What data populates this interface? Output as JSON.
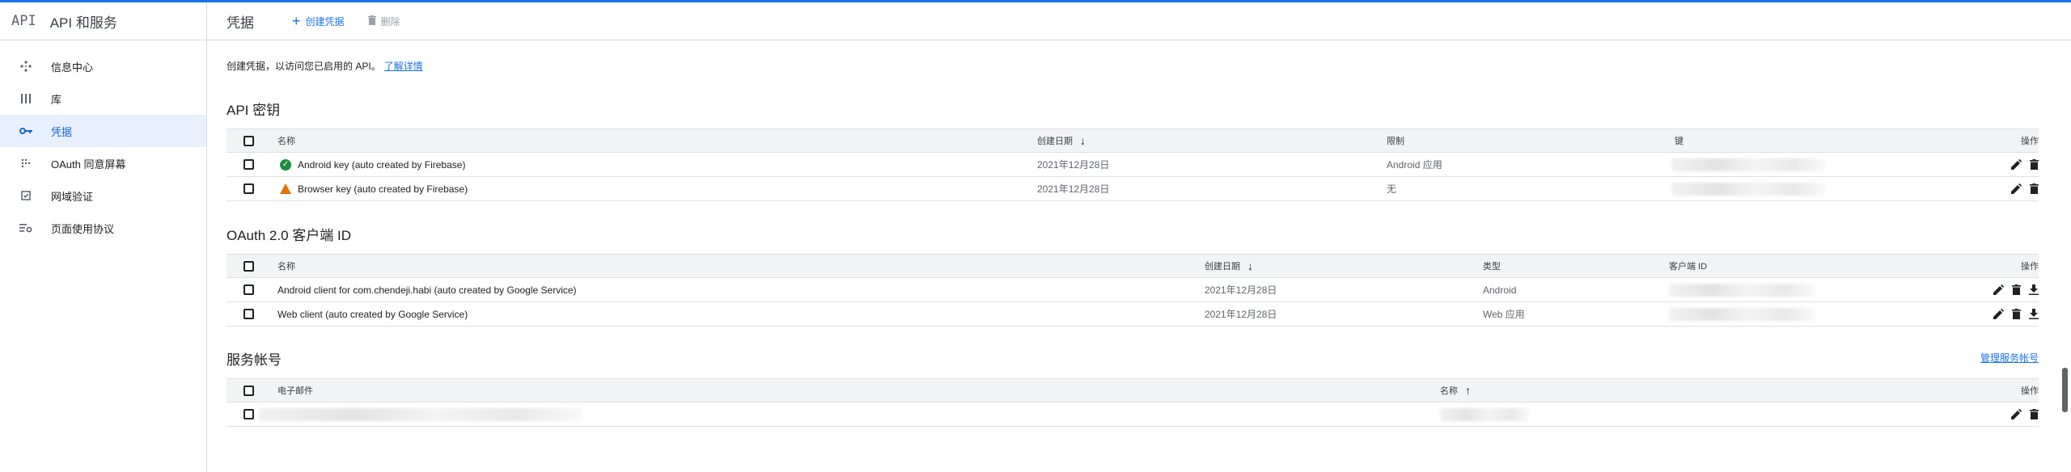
{
  "sidebar": {
    "logo": "API",
    "title": "API 和服务",
    "items": [
      {
        "label": "信息中心",
        "icon": "diamond-dots-icon"
      },
      {
        "label": "库",
        "icon": "library-grid-icon"
      },
      {
        "label": "凭据",
        "icon": "key-icon",
        "active": true
      },
      {
        "label": "OAuth 同意屏幕",
        "icon": "dots-grid-icon"
      },
      {
        "label": "网域验证",
        "icon": "checkbox-icon"
      },
      {
        "label": "页面使用协议",
        "icon": "settings-list-icon"
      }
    ]
  },
  "header": {
    "title": "凭据",
    "create_label": "创建凭据",
    "delete_label": "删除"
  },
  "main": {
    "intro_text": "创建凭据，以访问您已启用的 API。",
    "intro_link": "了解详情",
    "api_keys": {
      "title": "API 密钥",
      "headers": {
        "name": "名称",
        "created": "创建日期",
        "restriction": "限制",
        "key": "键",
        "actions": "操作"
      },
      "rows": [
        {
          "name": "Android key (auto created by Firebase)",
          "status": "ok",
          "created": "2021年12月28日",
          "restriction": "Android 应用"
        },
        {
          "name": "Browser key (auto created by Firebase)",
          "status": "warning",
          "created": "2021年12月28日",
          "restriction": "无"
        }
      ]
    },
    "oauth": {
      "title": "OAuth 2.0 客户端 ID",
      "headers": {
        "name": "名称",
        "created": "创建日期",
        "type": "类型",
        "client_id": "客户端 ID",
        "actions": "操作"
      },
      "rows": [
        {
          "name": "Android client for com.chendeji.habi (auto created by Google Service)",
          "created": "2021年12月28日",
          "type": "Android"
        },
        {
          "name": "Web client (auto created by Google Service)",
          "created": "2021年12月28日",
          "type": "Web 应用"
        }
      ]
    },
    "service_accounts": {
      "title": "服务帐号",
      "manage_link": "管理服务帐号",
      "headers": {
        "email": "电子邮件",
        "name": "名称",
        "actions": "操作"
      }
    }
  },
  "colors": {
    "accent": "#1a73e8",
    "active_bg": "#e8f0fe",
    "ok": "#1e8e3e",
    "warning": "#e37400"
  }
}
